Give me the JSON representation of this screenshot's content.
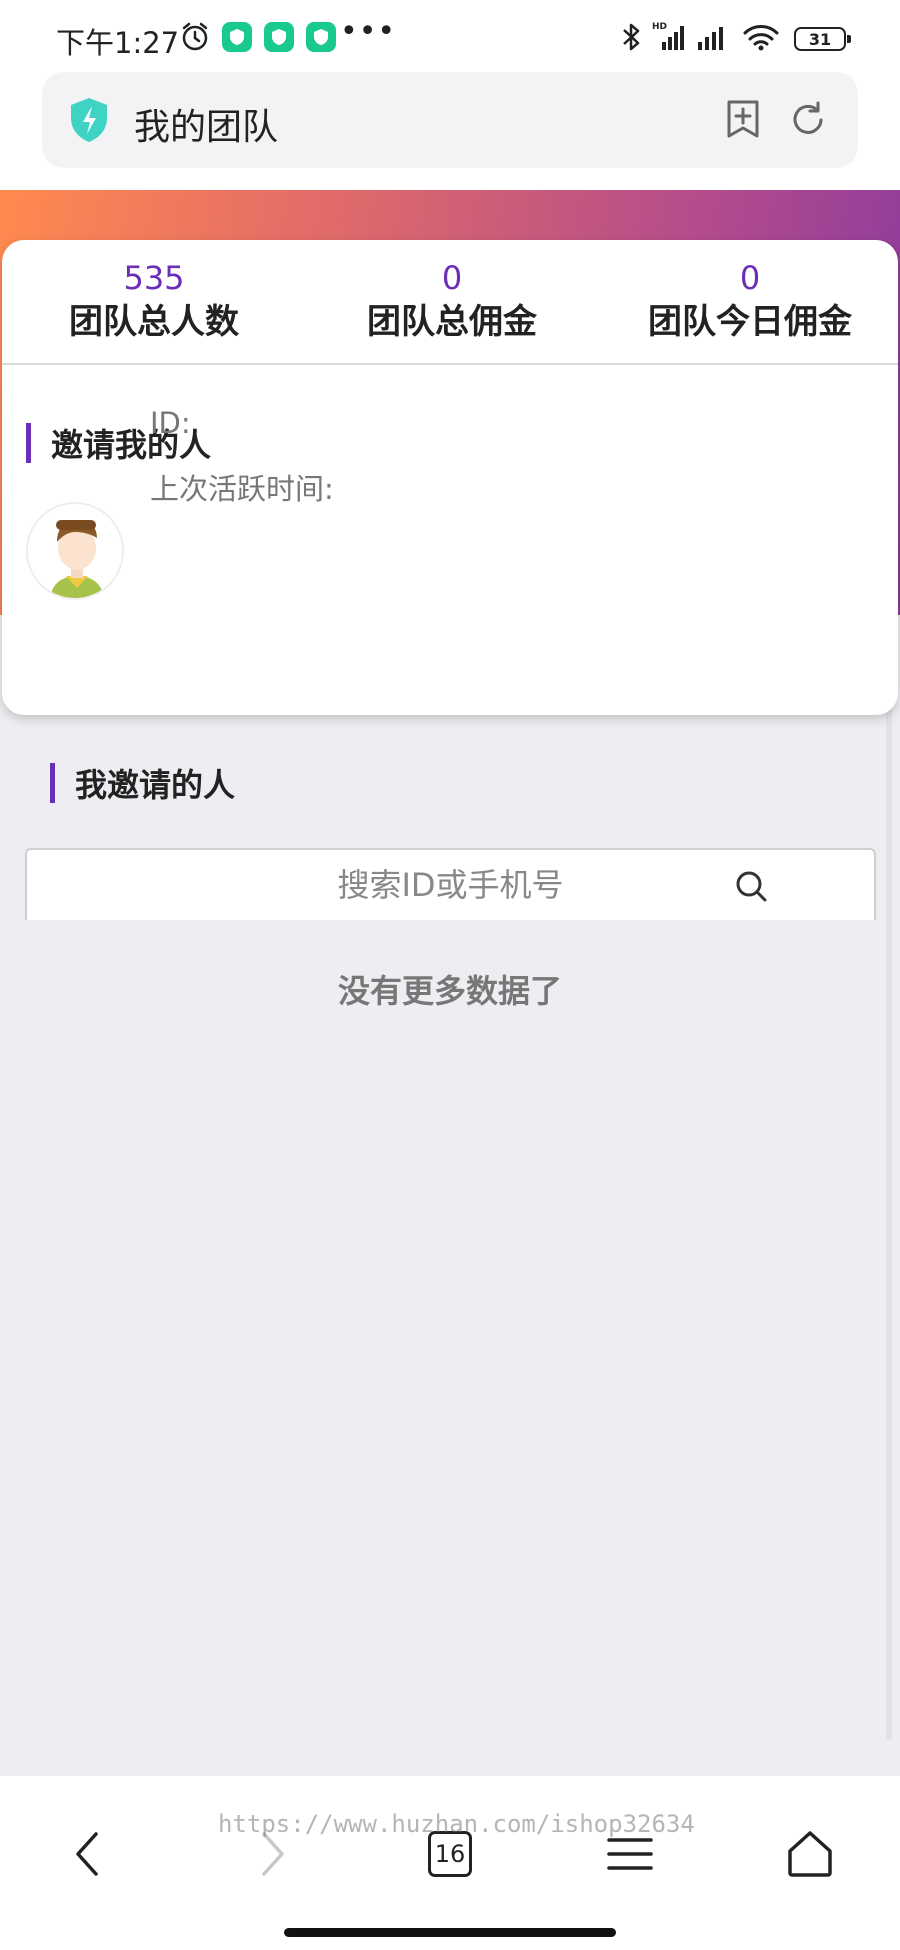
{
  "status_bar": {
    "time": "下午1:27",
    "battery": "31"
  },
  "browser": {
    "page_title": "我的团队"
  },
  "stats": [
    {
      "value": "535",
      "label": "团队总人数"
    },
    {
      "value": "0",
      "label": "团队总佣金"
    },
    {
      "value": "0",
      "label": "团队今日佣金"
    }
  ],
  "inviter": {
    "section_title": "邀请我的人",
    "id_label": "ID:",
    "last_active_label": "上次活跃时间:"
  },
  "invited": {
    "section_title": "我邀请的人",
    "search_placeholder": "搜索ID或手机号",
    "empty_message": "没有更多数据了"
  },
  "bottom_nav": {
    "tab_count": "16"
  },
  "watermark": "https://www.huzhan.com/ishop32634",
  "colors": {
    "accent": "#6a2fb4",
    "gradient_start": "#ff8a4f",
    "gradient_end": "#8a3a9e",
    "app_badge": "#19c98d",
    "shield": "#3fd3c4"
  }
}
